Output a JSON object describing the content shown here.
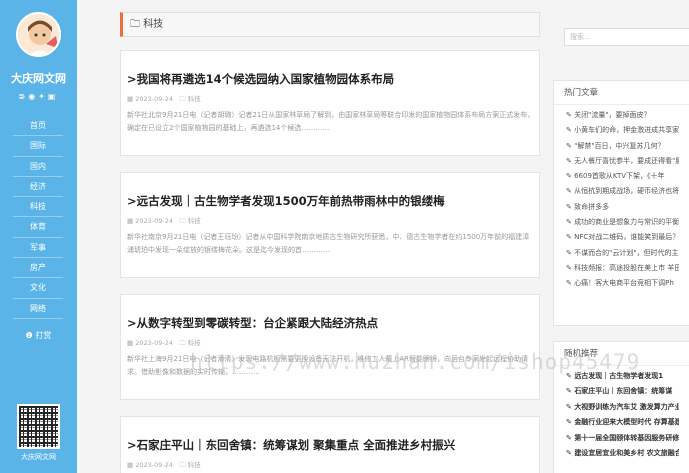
{
  "sidebar": {
    "site_name": "大庆网文网",
    "social_icons": [
      "rss-icon",
      "weibo-icon",
      "twitter-icon",
      "facebook-icon"
    ],
    "nav": [
      "首页",
      "国际",
      "国内",
      "经济",
      "科技",
      "体育",
      "军事",
      "房产",
      "文化",
      "网络"
    ],
    "donate": "打赏",
    "qr_label": "大庆网文网"
  },
  "category": {
    "label": "科技"
  },
  "posts": [
    {
      "title": ">我国将再遴选14个候选园纳入国家植物园体系布局",
      "date": "2023-09-24",
      "cat": "科技",
      "excerpt": "新华社北京9月21日电（记者胡璐）记者21日从国家林草局了解到，由国家林草局等联合印发的国家植物园体系布局方案正式发布，确定在已设立2个国家植物园的基础上，再遴选14个候选…………"
    },
    {
      "title": ">远古发现｜古生物学者发现1500万年前热带雨林中的银缕梅",
      "date": "2023-09-24",
      "cat": "科技",
      "excerpt": "新华社南京9月21日电（记者王珏玢）记者从中国科学院南京地质古生物研究所获悉，中、德古生物学者在约1500万年前的福建漳浦琥珀中发现一朵绽放的银缕梅花朵。这是迄今发现的首…………"
    },
    {
      "title": ">从数字转型到零碳转型：台企紧跟大陆经济热点",
      "date": "2023-09-24",
      "cat": "科技",
      "excerpt": "新华社上海9月21日电（记者潘清）发现电路机板需要更换设备无法开机，维修工人戴上AR智能眼镜，向后台专家发起远程协助请求。借助影像和数据的实时传输，…………"
    },
    {
      "title": ">石家庄平山｜东回舍镇：统筹谋划 聚集重点 全面推进乡村振兴",
      "date": "2023-09-24",
      "cat": "科技",
      "excerpt": ""
    }
  ],
  "search": {
    "placeholder": "搜索..."
  },
  "hot": {
    "title": "热门文章",
    "items": [
      "关闭\"流量\"，要掉面皮？",
      "小黄车们的命，押金激进成共享家",
      "\"解禁\"百日，中兴复苏几何？",
      "无人餐厅喜忧参半，要成还得看\"腰",
      "6609首歌从KTV下架，《十年",
      "从恒杭到期成战场，硬币经济也将被",
      "致命拼多多",
      "成功的商业是想象力与常识的平衡",
      "NFC对战二维码，谁能笑到最后？",
      "不谋而合的\"云计划\"，但时代的主",
      "科技频报：高途投股在美上市 羊田",
      "心痛！客大电商平台竞相下调Ph"
    ]
  },
  "random": {
    "title": "随机推荐",
    "items": [
      "远古发现｜古生物学者发现1",
      "石家庄平山｜东回舍镇：统筹谋",
      "大视野训练为汽车艾 激发算力产业",
      "金融行业迎来大模型时代 存算基建",
      "第十一届全国颐体转基因服务研修班",
      "建设宜居宜业和美乡村 农文旅融合"
    ]
  },
  "watermark": "https://www.huzhan.com/ishop45479"
}
